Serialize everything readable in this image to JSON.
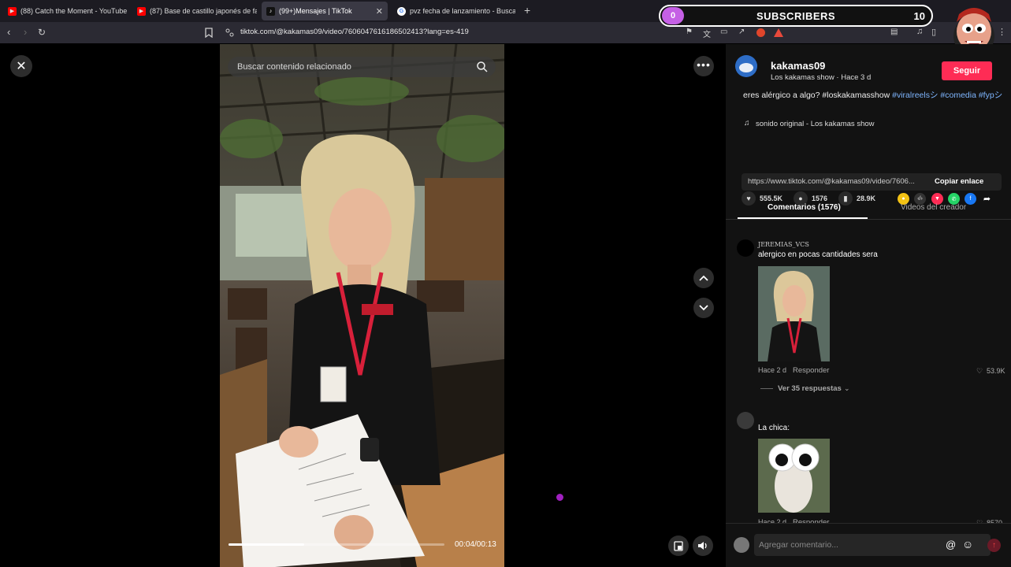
{
  "browser": {
    "tabs": [
      {
        "label": "(88) Catch the Moment - YouTube"
      },
      {
        "label": "(87) Base de castillo japonés de fanta"
      },
      {
        "label": "(99+)Mensajes | TikTok"
      },
      {
        "label": "pvz fecha de lanzamiento - Buscar co"
      }
    ],
    "new_tab": "+",
    "url": "tiktok.com/@kakamas09/video/7606047616186502413?lang=es-419"
  },
  "overlay": {
    "dot_value": "0",
    "label": "SUBSCRIBERS",
    "count": "10"
  },
  "video": {
    "search_placeholder": "Buscar contenido relacionado",
    "time": "00:04/00:13",
    "progress_fraction": 0.35
  },
  "panel": {
    "author": "kakamas09",
    "author_sub": "Los kakamas show · Hace 3 d",
    "follow": "Seguir",
    "caption": "eres alérgico a algo? #loskakamasshow",
    "hashtag_1": "#viralreelsシ",
    "hashtag_2": "#comedia",
    "hashtag_3": "#fypシ",
    "sound": "sonido original - Los kakamas show",
    "likes": "555.5K",
    "comments": "1576",
    "saves": "28.9K",
    "link_url": "https://www.tiktok.com/@kakamas09/video/7606...",
    "copy_link": "Copiar enlace",
    "tab_comments": "Comentarios (1576)",
    "tab_videos": "Videos del creador",
    "comment_1": {
      "user": "JEREMIAS_VCS",
      "text": "alergico en pocas cantidades sera",
      "meta": "Hace 2 d",
      "reply": "Responder",
      "likes": "53.9K",
      "view_replies": "Ver 35 respuestas"
    },
    "comment_2": {
      "text": "La chica:",
      "meta": "Hace 2 d",
      "reply": "Responder",
      "likes": "8570"
    },
    "add_comment_placeholder": "Agregar comentario...",
    "at_symbol": "@"
  },
  "colors": {
    "accent": "#fe2c55",
    "hashtag": "#7fb6ff",
    "subs_dot": "#c560e5"
  }
}
